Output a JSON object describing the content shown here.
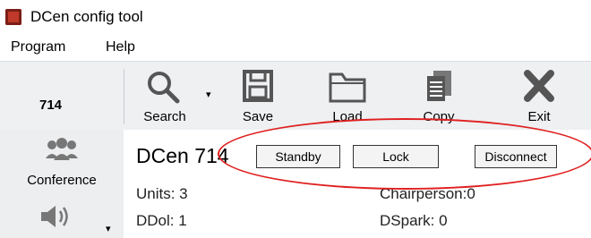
{
  "window": {
    "title": "DCen config tool"
  },
  "menu": {
    "items": [
      "Program",
      "Help"
    ]
  },
  "toolbar": {
    "device_id": "714",
    "search_label": "Search",
    "save_label": "Save",
    "load_label": "Load",
    "copy_label": "Copy",
    "exit_label": "Exit"
  },
  "sidebar": {
    "conference_label": "Conference"
  },
  "main": {
    "device_title": "DCen 714",
    "buttons": {
      "standby": "Standby",
      "lock": "Lock",
      "disconnect": "Disconnect"
    },
    "info": {
      "units": "Units: 3",
      "ddol": "DDol: 1",
      "chairperson": "Chairperson:0",
      "dspark": "DSpark: 0"
    }
  },
  "colors": {
    "annotation": "#e02020",
    "app_icon": "#c0392b",
    "toolbar_bg": "#eef0f2"
  },
  "icons": [
    "app-icon",
    "search-icon",
    "save-icon",
    "folder-icon",
    "copy-icon",
    "close-icon",
    "conference-icon",
    "speaker-icon"
  ]
}
